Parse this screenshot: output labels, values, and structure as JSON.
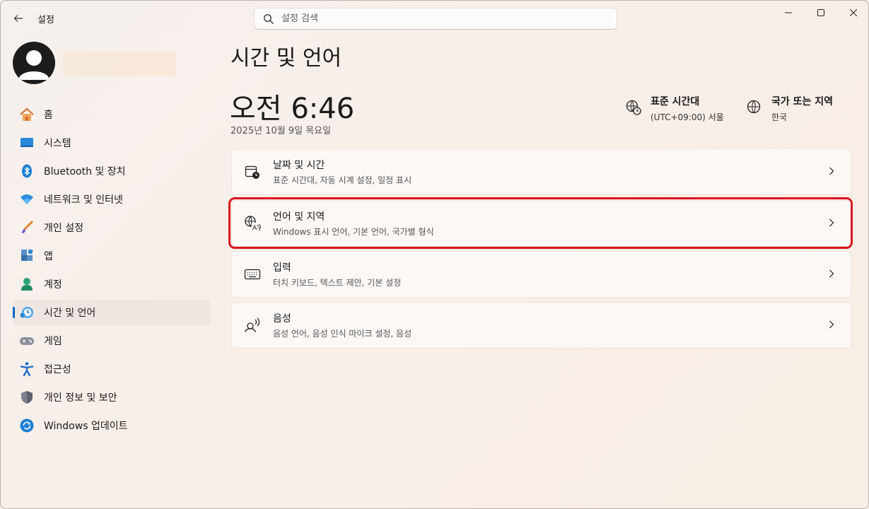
{
  "window": {
    "app_title": "설정"
  },
  "search": {
    "placeholder": "설정 검색"
  },
  "sidebar": {
    "items": [
      {
        "label": "홈",
        "icon": "home-icon"
      },
      {
        "label": "시스템",
        "icon": "system-icon"
      },
      {
        "label": "Bluetooth 및 장치",
        "icon": "bluetooth-icon"
      },
      {
        "label": "네트워크 및 인터넷",
        "icon": "wifi-icon"
      },
      {
        "label": "개인 설정",
        "icon": "brush-icon"
      },
      {
        "label": "앱",
        "icon": "apps-icon"
      },
      {
        "label": "계정",
        "icon": "account-icon"
      },
      {
        "label": "시간 및 언어",
        "icon": "time-language-icon",
        "selected": true
      },
      {
        "label": "게임",
        "icon": "gamepad-icon"
      },
      {
        "label": "접근성",
        "icon": "accessibility-icon"
      },
      {
        "label": "개인 정보 및 보안",
        "icon": "shield-icon"
      },
      {
        "label": "Windows 업데이트",
        "icon": "update-icon"
      }
    ]
  },
  "main": {
    "title": "시간 및 언어",
    "clock": "오전 6:46",
    "date": "2025년 10월 9일 목요일",
    "timezone": {
      "title": "표준 시간대",
      "value": "(UTC+09:00) 서울"
    },
    "region": {
      "title": "국가 또는 지역",
      "value": "한국"
    },
    "cards": [
      {
        "title": "날짜 및 시간",
        "subtitle": "표준 시간대, 자동 시계 설정, 일정 표시"
      },
      {
        "title": "언어 및 지역",
        "subtitle": "Windows 표시 언어, 기본 언어, 국가별 형식",
        "highlighted": true
      },
      {
        "title": "입력",
        "subtitle": "터치 키보드, 텍스트 제안, 기본 설정"
      },
      {
        "title": "음성",
        "subtitle": "음성 언어, 음성 인식 마이크 설정, 음성"
      }
    ]
  },
  "colors": {
    "accent": "#0067c0",
    "highlight": "#d9141e"
  }
}
